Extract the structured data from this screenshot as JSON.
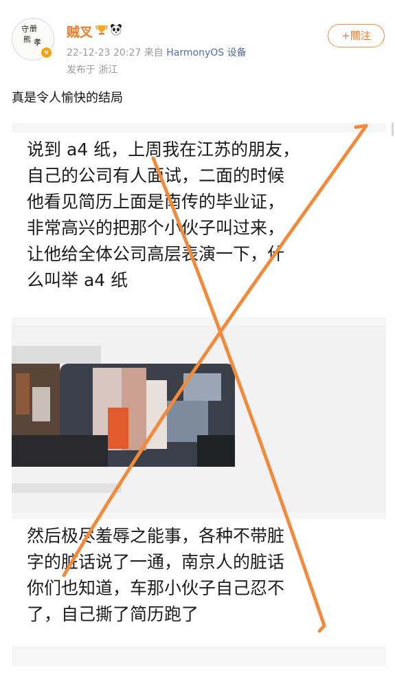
{
  "author": {
    "name": "贼叉",
    "avatar_text": "守册熊孝",
    "verified_icon": "v-verified-icon",
    "badges": [
      "trophy-icon",
      "panda-icon"
    ]
  },
  "meta": {
    "datetime": "22-12-23 20:27",
    "from_prefix": "来自",
    "device": "HarmonyOS 设备",
    "location": "发布于 浙江"
  },
  "follow_label": "+關注",
  "caption": "真是令人愉快的结局",
  "embedded_post": {
    "paragraph_1": [
      "说到 a4 纸，上周我在江苏的朋友，",
      "自己的公司有人面试，二面的时候",
      "他看见简历上面是南传的毕业证，",
      "非常高兴的把那个小伙子叫过来，",
      "让他给全体公司高层表演一下，什",
      "么叫举 a4 纸"
    ],
    "image": "pixelated-photo",
    "paragraph_2": [
      "然后极尽羞辱之能事，各种不带脏",
      "字的脏话说了一通，南京人的脏话",
      "你们也知道，车那小伙子自己忍不",
      "了，自己撕了简历跑了"
    ]
  },
  "overlay": {
    "mark": "orange-cross",
    "color": "#f28a3c"
  },
  "colors": {
    "accent": "#ef7a2a",
    "device_link": "#4e6ea8",
    "meta": "#9a9a9a"
  }
}
